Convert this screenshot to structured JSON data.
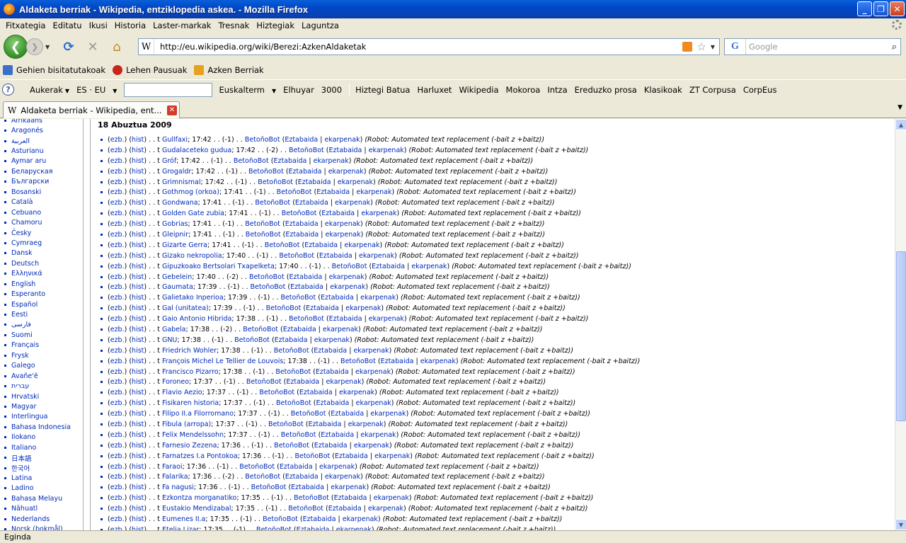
{
  "window": {
    "title": "Aldaketa berriak - Wikipedia, entziklopedia askea. - Mozilla Firefox",
    "buttons": {
      "minimize": "_",
      "maximize": "❐",
      "close": "✕"
    }
  },
  "menubar": [
    "Fitxategia",
    "Editatu",
    "Ikusi",
    "Historia",
    "Laster-markak",
    "Tresnak",
    "Hiztegiak",
    "Laguntza"
  ],
  "navbar": {
    "url": "http://eu.wikipedia.org/wiki/Berezi:AzkenAldaketak",
    "search_placeholder": "Google",
    "search_engine": "G"
  },
  "bookmarks": [
    {
      "label": "Gehien bisitatutakoak",
      "icon": "bookmark-folder-icon",
      "color": "#3b6fc9"
    },
    {
      "label": "Lehen Pausuak",
      "icon": "firefox-red-icon",
      "color": "#c8261a"
    },
    {
      "label": "Azken Berriak",
      "icon": "rss-feed-icon",
      "color": "#e6a11e"
    }
  ],
  "custom_toolbar": {
    "aukerak": "Aukerak",
    "langpair": "ES · EU",
    "euskalterm": "Euskalterm",
    "items": [
      "Elhuyar",
      "3000",
      "Hiztegi Batua",
      "Harluxet",
      "Wikipedia",
      "Mokoroa",
      "Intza",
      "Ereduzko prosa",
      "Klasikoak",
      "ZT Corpusa",
      "CorpEus"
    ]
  },
  "tab": {
    "label": "Aldaketa berriak - Wikipedia, ent...",
    "close": "✕"
  },
  "sidebar_languages": [
    "Afrikaans",
    "Aragonés",
    "العربية",
    "Asturianu",
    "Aymar aru",
    "Беларуская",
    "Български",
    "Bosanski",
    "Català",
    "Cebuano",
    "Chamoru",
    "Česky",
    "Cymraeg",
    "Dansk",
    "Deutsch",
    "Ελληνικά",
    "English",
    "Esperanto",
    "Español",
    "Eesti",
    "فارسی",
    "Suomi",
    "Français",
    "Frysk",
    "Galego",
    "Avañe'ẽ",
    "עברית",
    "Hrvatski",
    "Magyar",
    "Interlingua",
    "Bahasa Indonesia",
    "Ilokano",
    "Italiano",
    "日本語",
    "한국어",
    "Latina",
    "Ladino",
    "Bahasa Melayu",
    "Nāhuatl",
    "Nederlands",
    "Norsk (bokmål)"
  ],
  "date_heading": "18 Abuztua 2009",
  "common": {
    "diff": "ezb.",
    "hist": "hist",
    "flag": "t",
    "user": "BetoñoBot",
    "talk": "Eztabaida",
    "contribs": "ekarpenak",
    "summary": "(Robot: Automated text replacement (-bait z +baitz))"
  },
  "changes": [
    {
      "title": "Gullfaxi",
      "time": "17:42",
      "size": "(-1)"
    },
    {
      "title": "Gudalaceteko gudua",
      "time": "17:42",
      "size": "(-2)"
    },
    {
      "title": "Gróf",
      "time": "17:42",
      "size": "(-1)"
    },
    {
      "title": "Grogaldr",
      "time": "17:42",
      "size": "(-1)"
    },
    {
      "title": "Grimnismal",
      "time": "17:42",
      "size": "(-1)"
    },
    {
      "title": "Gothmog (orkoa)",
      "time": "17:41",
      "size": "(-1)"
    },
    {
      "title": "Gondwana",
      "time": "17:41",
      "size": "(-1)"
    },
    {
      "title": "Golden Gate zubia",
      "time": "17:41",
      "size": "(-1)"
    },
    {
      "title": "Gobrias",
      "time": "17:41",
      "size": "(-1)"
    },
    {
      "title": "Gleipnir",
      "time": "17:41",
      "size": "(-1)"
    },
    {
      "title": "Gizarte Gerra",
      "time": "17:41",
      "size": "(-1)"
    },
    {
      "title": "Gizako nekropolia",
      "time": "17:40",
      "size": "(-1)"
    },
    {
      "title": "Gipuzkoako Bertsolari Txapelketa",
      "time": "17:40",
      "size": "(-1)"
    },
    {
      "title": "Gebelein",
      "time": "17:40",
      "size": "(-2)"
    },
    {
      "title": "Gaumata",
      "time": "17:39",
      "size": "(-1)"
    },
    {
      "title": "Galietako Inperioa",
      "time": "17:39",
      "size": "(-1)"
    },
    {
      "title": "Gal (unitatea)",
      "time": "17:39",
      "size": "(-1)"
    },
    {
      "title": "Gaio Antonio Hibrida",
      "time": "17:38",
      "size": "(-1)"
    },
    {
      "title": "Gabela",
      "time": "17:38",
      "size": "(-2)"
    },
    {
      "title": "GNU",
      "time": "17:38",
      "size": "(-1)"
    },
    {
      "title": "Friedrich Wohler",
      "time": "17:38",
      "size": "(-1)"
    },
    {
      "title": "François Michel Le Tellier de Louvois",
      "time": "17:38",
      "size": "(-1)"
    },
    {
      "title": "Francisco Pizarro",
      "time": "17:38",
      "size": "(-1)"
    },
    {
      "title": "Foroneo",
      "time": "17:37",
      "size": "(-1)"
    },
    {
      "title": "Flavio Aezio",
      "time": "17:37",
      "size": "(-1)"
    },
    {
      "title": "Fisikaren historia",
      "time": "17:37",
      "size": "(-1)"
    },
    {
      "title": "Filipo II.a Filorromano",
      "time": "17:37",
      "size": "(-1)"
    },
    {
      "title": "Fibula (arropa)",
      "time": "17:37",
      "size": "(-1)"
    },
    {
      "title": "Felix Mendelssohn",
      "time": "17:37",
      "size": "(-1)"
    },
    {
      "title": "Farnesio Zezena",
      "time": "17:36",
      "size": "(-1)"
    },
    {
      "title": "Farnatzes I.a Pontokoa",
      "time": "17:36",
      "size": "(-1)"
    },
    {
      "title": "Faraoi",
      "time": "17:36",
      "size": "(-1)"
    },
    {
      "title": "Falarika",
      "time": "17:36",
      "size": "(-2)"
    },
    {
      "title": "Fa nagusi",
      "time": "17:36",
      "size": "(-1)"
    },
    {
      "title": "Ezkontza morganatiko",
      "time": "17:35",
      "size": "(-1)"
    },
    {
      "title": "Eustakio Mendizabal",
      "time": "17:35",
      "size": "(-1)"
    },
    {
      "title": "Eumenes II.a",
      "time": "17:35",
      "size": "(-1)"
    },
    {
      "title": "Etelia Lizar",
      "time": "17:35",
      "size": "(-1)"
    }
  ],
  "status": "Egindа"
}
